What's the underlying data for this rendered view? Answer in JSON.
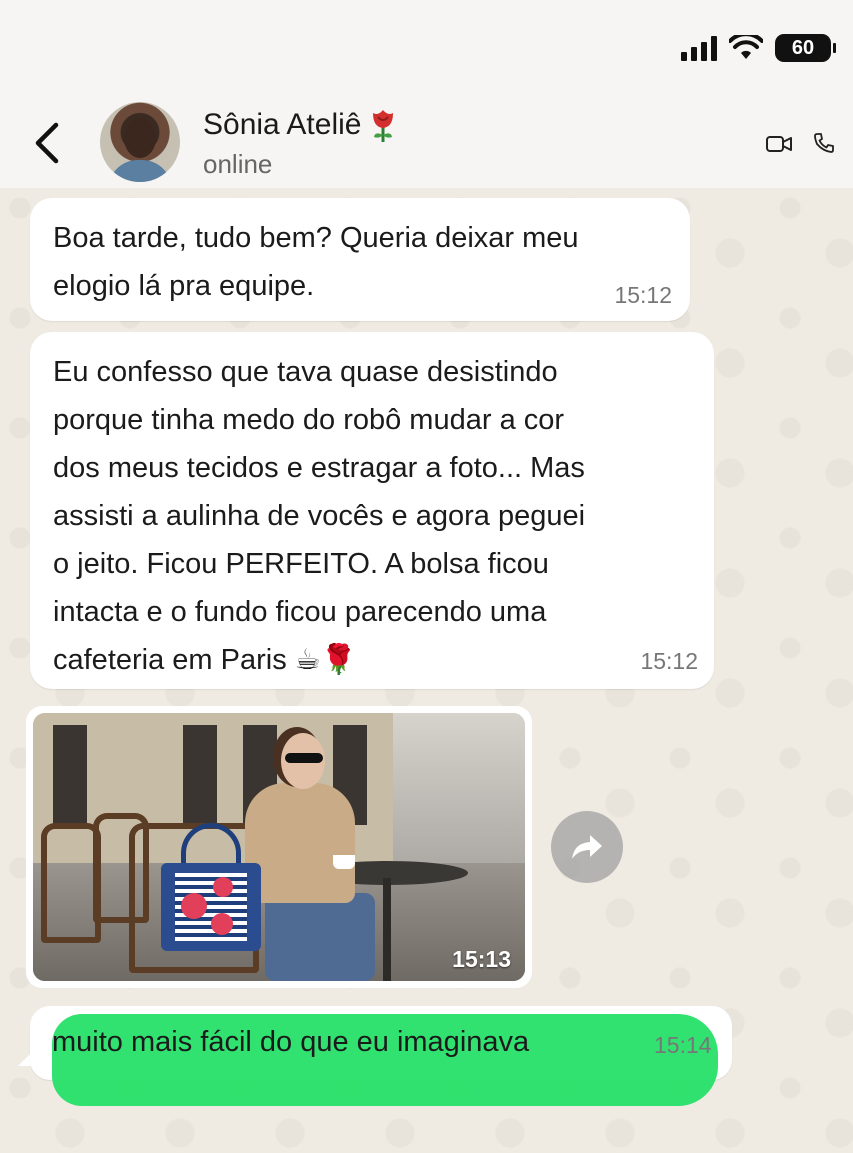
{
  "status_bar": {
    "battery": "60",
    "signal_bars": 4
  },
  "header": {
    "contact_name": "Sônia Ateliê",
    "contact_emoji": "rose",
    "status": "online",
    "icons": [
      "back-icon",
      "video-call-icon",
      "phone-icon"
    ]
  },
  "messages": [
    {
      "text": "Boa tarde, tudo bem? Queria deixar meu\nelogio lá pra equipe.",
      "time": "15:12"
    },
    {
      "text": "Eu confesso que tava quase desistindo\nporque tinha medo do robô mudar a cor\ndos meus tecidos e estragar a foto... Mas\nassisti a aulinha de vocês e agora peguei\no jeito. Ficou PERFEITO. A bolsa ficou\nintacta e o fundo ficou parecendo uma\ncafeteria em Paris ☕🌹",
      "time": "15:12"
    },
    {
      "type": "image",
      "time": "15:13"
    },
    {
      "text": "muito mais fácil do que eu imaginava",
      "time": "15:14"
    }
  ],
  "colors": {
    "highlight": "#26e068",
    "chat_bg": "#efeae2",
    "bubble": "#ffffff"
  }
}
